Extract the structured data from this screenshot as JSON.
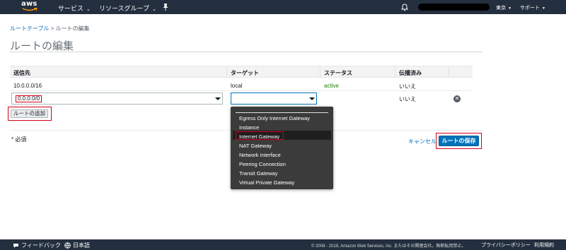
{
  "topnav": {
    "logo_text": "aws",
    "services_label": "サービス",
    "resource_groups_label": "リソースグループ",
    "region_label": "東京",
    "support_label": "サポート",
    "icons": [
      "bell-icon",
      "pin-icon",
      "chevron-down-icon"
    ]
  },
  "breadcrumb": {
    "parent": "ルートテーブル",
    "separator": ">",
    "current": "ルートの編集"
  },
  "page_title": "ルートの編集",
  "table": {
    "headers": [
      "送信先",
      "ターゲット",
      "ステータス",
      "伝播済み"
    ],
    "rows": [
      {
        "destination": "10.0.0.0/16",
        "target": "local",
        "status": "active",
        "propagated": "いいえ"
      }
    ],
    "new_row": {
      "destination_value": "0.0.0.0/0",
      "target_value": "",
      "propagated": "いいえ"
    }
  },
  "add_route_label": "ルートの追加",
  "required_note": "* 必須",
  "cancel_label": "キャンセル",
  "save_label": "ルートの保存",
  "dropdown": {
    "options": [
      "Egress Only Internet Gateway",
      "Instance",
      "Internet Gateway",
      "NAT Gateway",
      "Network Interface",
      "Peering Connection",
      "Transit Gateway",
      "Virtual Private Gateway"
    ],
    "highlighted": "Internet Gateway"
  },
  "footer": {
    "feedback_label": "フィードバック",
    "language_label": "日本語",
    "copyright": "© 2008 - 2019, Amazon Web Services, Inc. またはその関連会社。無断転用禁止。",
    "privacy_label": "プライバシーポリシー",
    "terms_label": "利用規約"
  },
  "colors": {
    "nav_bg": "#232f3e",
    "link": "#0073bb",
    "status_active": "#1d8102",
    "highlight_border": "#d0021b",
    "dropdown_bg": "#3b3b3b"
  }
}
